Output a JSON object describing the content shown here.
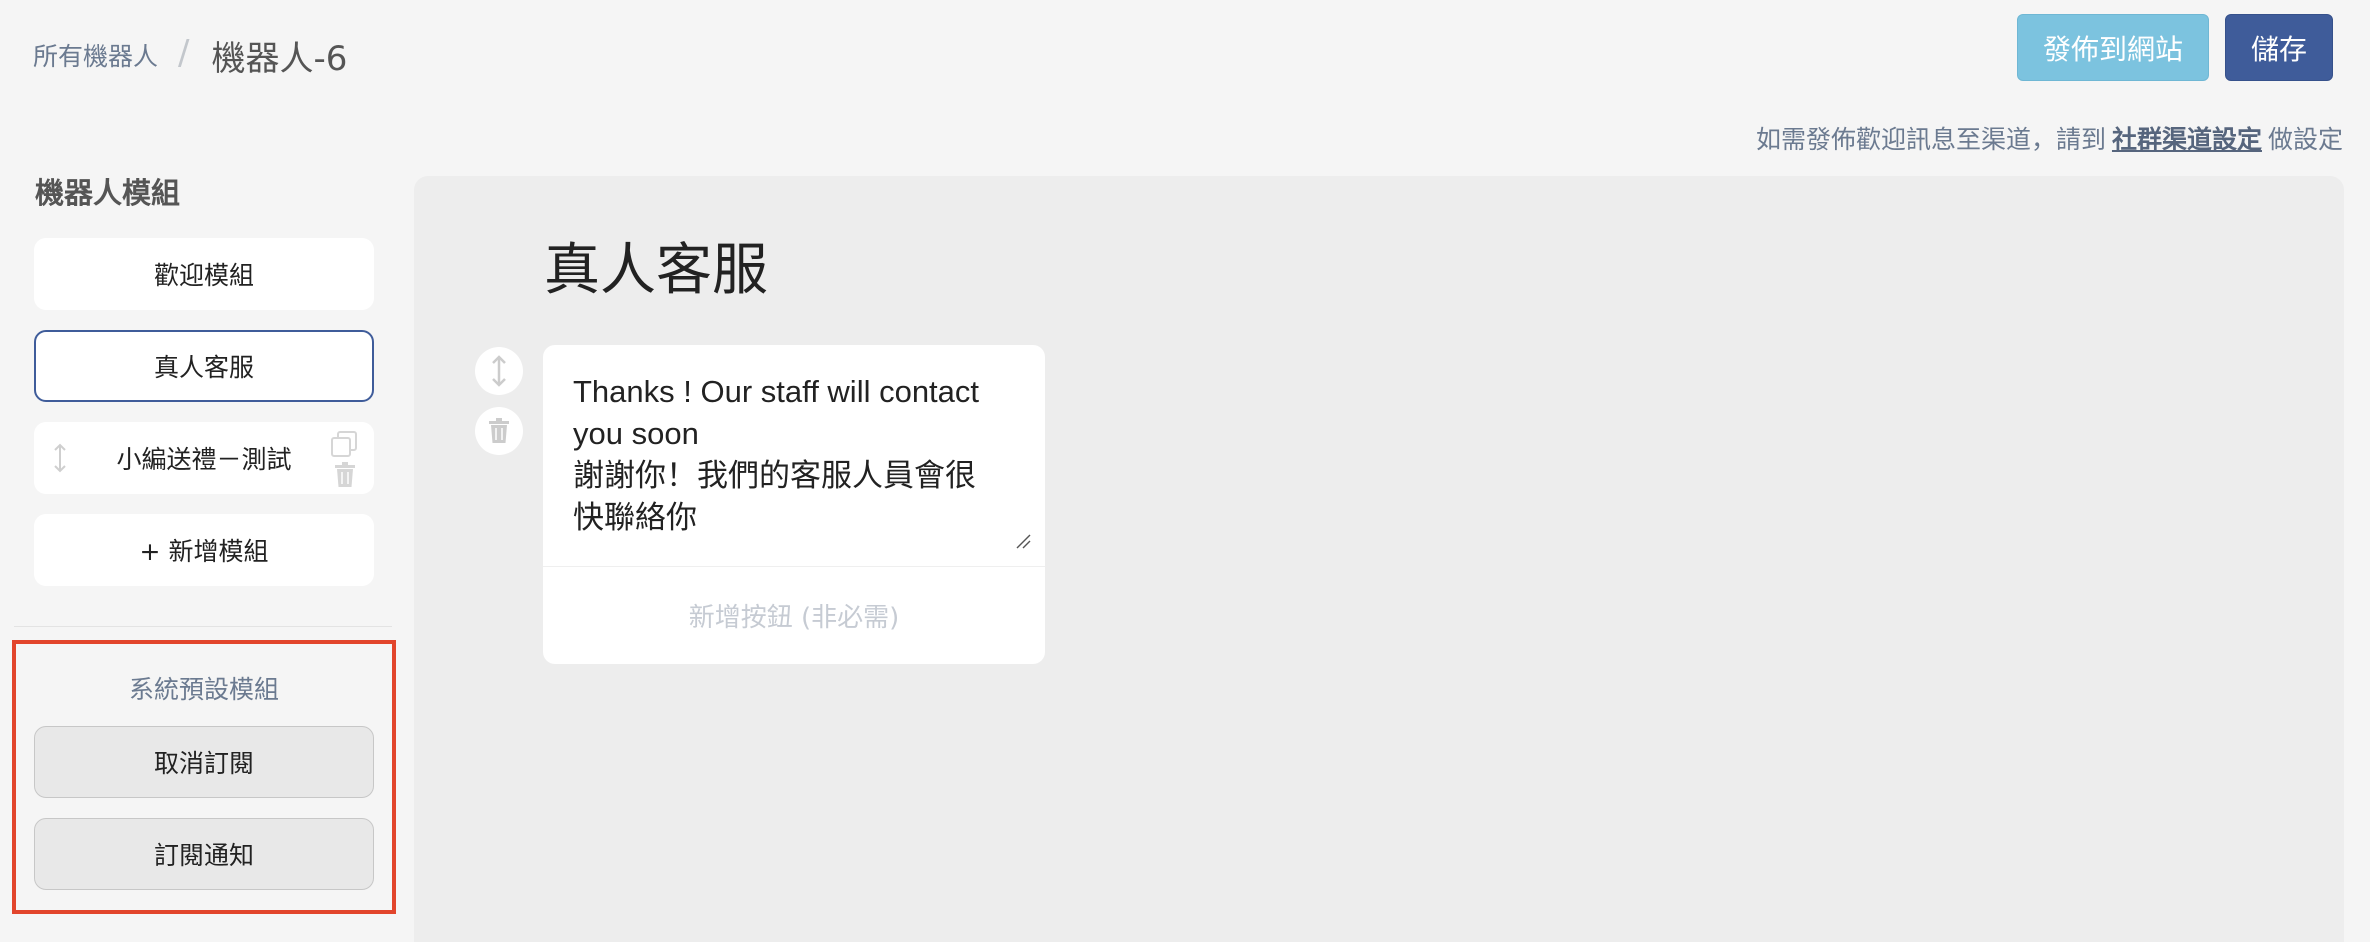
{
  "breadcrumb": {
    "parent": "所有機器人",
    "separator": "/",
    "current": "機器人-6"
  },
  "header": {
    "publish_label": "發佈到網站",
    "save_label": "儲存"
  },
  "hint": {
    "prefix": "如需發佈歡迎訊息至渠道，請到",
    "link": "社群渠道設定",
    "suffix": "做設定"
  },
  "sidebar": {
    "title": "機器人模組",
    "modules": [
      {
        "label": "歡迎模組",
        "active": false
      },
      {
        "label": "真人客服",
        "active": true
      },
      {
        "label": "小編送禮－測試",
        "active": false
      },
      {
        "label": "+ 新增模組",
        "active": false
      }
    ],
    "system_title": "系統預設模組",
    "system_modules": [
      {
        "label": "取消訂閱"
      },
      {
        "label": "訂閱通知"
      }
    ]
  },
  "main": {
    "title": "真人客服",
    "message_text": "Thanks ! Our staff will contact\nyou soon\n謝謝你！我們的客服人員會很\n快聯絡你",
    "add_button_label": "新增按鈕 (非必需)"
  },
  "colors": {
    "primary": "#3f5c9a",
    "publish": "#7cc3df",
    "highlight_box": "#e2452c",
    "muted_text": "#6b7a90"
  }
}
